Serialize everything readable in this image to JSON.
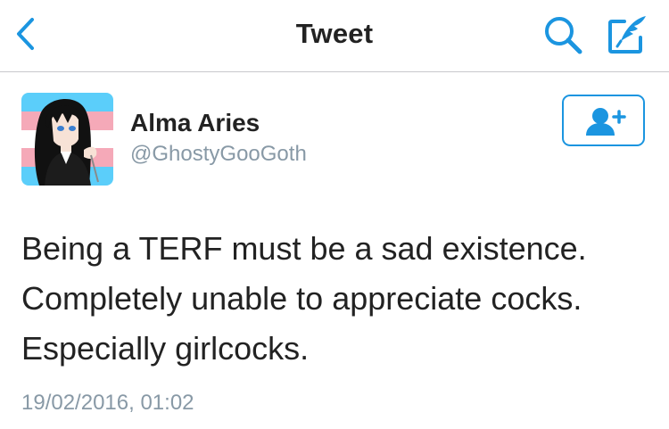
{
  "navbar": {
    "title": "Tweet",
    "back_icon": "chevron-left-icon",
    "search_icon": "search-icon",
    "compose_icon": "compose-tweet-icon"
  },
  "tweet": {
    "author": {
      "display_name": "Alma Aries",
      "handle": "@GhostyGooGoth",
      "avatar_icon": "profile-avatar"
    },
    "follow_icon": "add-user-icon",
    "text_lines": [
      "Being a TERF must be a sad existence.",
      "Completely unable to appreciate cocks.",
      "Especially girlcocks."
    ],
    "timestamp": "19/02/2016, 01:02"
  },
  "colors": {
    "accent": "#1b95e0",
    "text_primary": "#222222",
    "text_secondary": "#8899a6",
    "divider": "#c8c8cc",
    "flag_blue": "#5bcefa",
    "flag_pink": "#f5a9b8",
    "flag_white": "#ffffff"
  }
}
